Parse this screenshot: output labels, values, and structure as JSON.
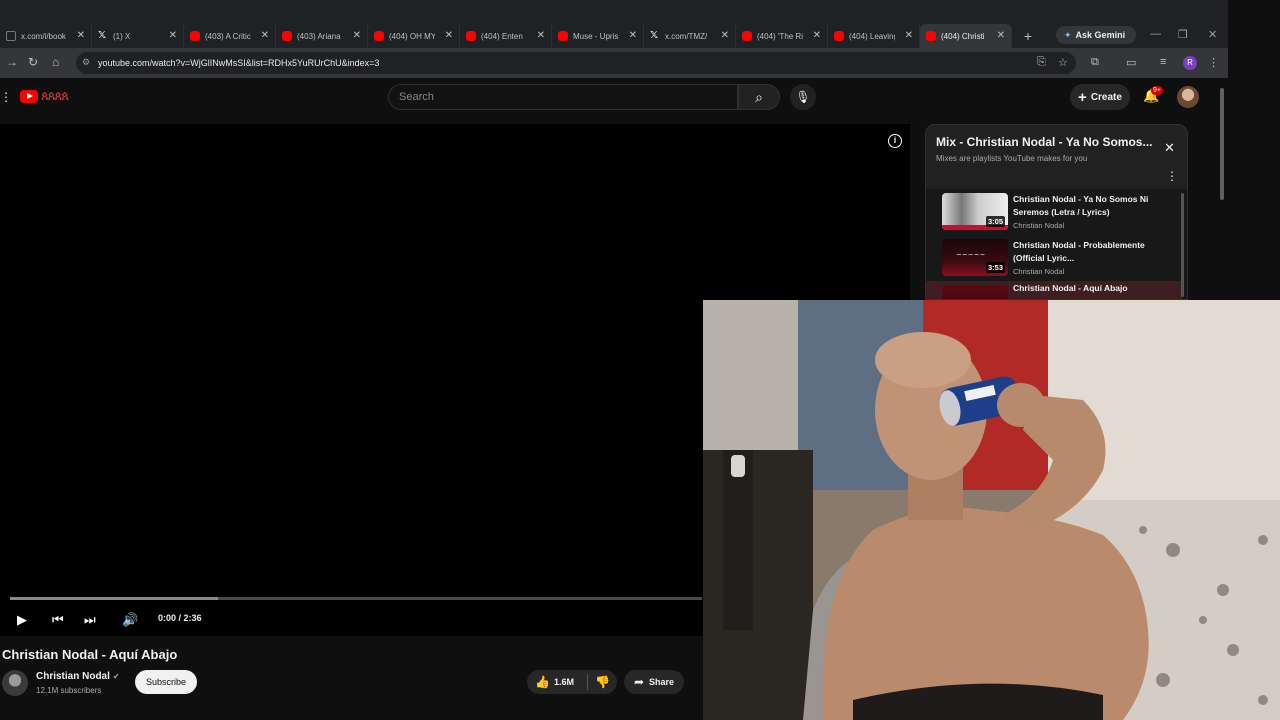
{
  "browser": {
    "tabs": [
      {
        "title": "x.com/i/book",
        "icon": "page-icon",
        "active": false
      },
      {
        "title": "(1) X",
        "icon": "x-logo-icon",
        "active": false
      },
      {
        "title": "(403) A Critic",
        "icon": "youtube-icon",
        "active": false
      },
      {
        "title": "(403) Ariana",
        "icon": "youtube-icon",
        "active": false
      },
      {
        "title": "(404) OH MY",
        "icon": "youtube-icon",
        "active": false
      },
      {
        "title": "(404) Enten",
        "icon": "youtube-icon",
        "active": false
      },
      {
        "title": "Muse - Upris",
        "icon": "youtube-icon",
        "active": false
      },
      {
        "title": "x.com/TMZ/",
        "icon": "x-logo-icon",
        "active": false
      },
      {
        "title": "(404) 'The Ri",
        "icon": "youtube-icon",
        "active": false
      },
      {
        "title": "(404) Leaving",
        "icon": "youtube-icon",
        "active": false
      },
      {
        "title": "(404) Christi",
        "icon": "youtube-icon",
        "active": true
      }
    ],
    "gemini_label": "Ask Gemini",
    "url": "youtube.com/watch?v=WjGlINwMsSI&list=RDHx5YuRUrChU&index=3",
    "profile_initial": "R"
  },
  "youtube": {
    "search_placeholder": "Search",
    "create_label": "Create",
    "notification_badge": "9+"
  },
  "player": {
    "current_time": "0:00",
    "duration": "2:36",
    "time_display": "0:00 / 2:36",
    "buffered_fraction": 0.3
  },
  "video": {
    "title": "Christian Nodal - Aquí Abajo",
    "channel": "Christian Nodal",
    "subscribers": "12.1M subscribers",
    "subscribe_label": "Subscribe",
    "likes": "1.6M",
    "share_label": "Share"
  },
  "playlist": {
    "title": "Mix - Christian Nodal - Ya No Somos...",
    "subtitle": "Mixes are playlists YouTube makes for you",
    "items": [
      {
        "title": "Christian Nodal - Ya No Somos Ni Seremos (Letra / Lyrics)",
        "channel": "Christian Nodal",
        "duration": "3:05",
        "active": false
      },
      {
        "title": "Christian Nodal - Probablemente (Official Lyric...",
        "channel": "Christian Nodal",
        "duration": "3:53",
        "active": false
      },
      {
        "title": "Christian Nodal - Aquí Abajo",
        "channel": "",
        "duration": "",
        "active": true
      }
    ]
  },
  "colors": {
    "yt_red": "#ff0000",
    "background": "#0f0f0f",
    "active_item": "#3e1e22"
  }
}
